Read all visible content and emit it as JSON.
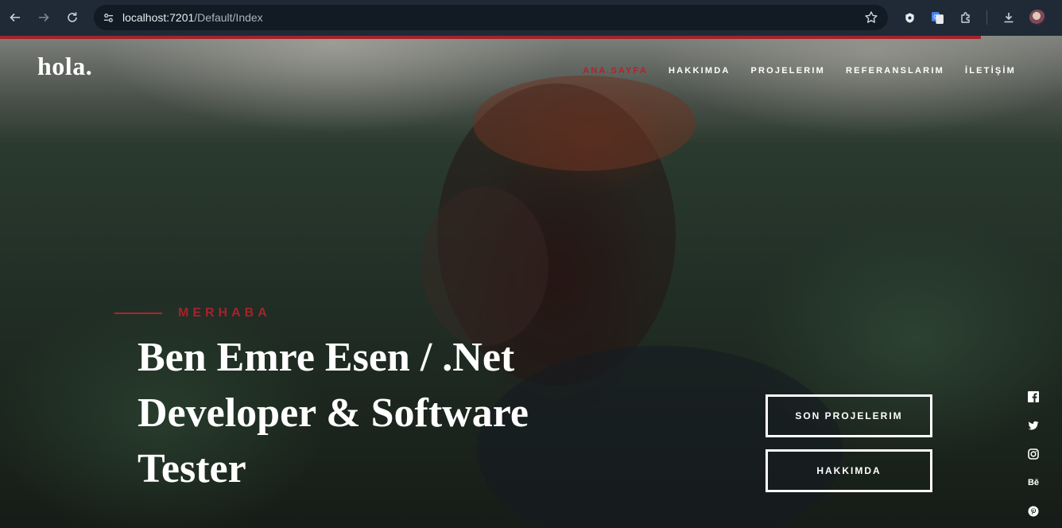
{
  "browser": {
    "url_host": "localhost:7201",
    "url_path": "/Default/Index"
  },
  "site": {
    "logo": "hola."
  },
  "nav": {
    "items": [
      {
        "label": "ANA SAYFA",
        "active": true
      },
      {
        "label": "HAKKIMDA",
        "active": false
      },
      {
        "label": "PROJELERIM",
        "active": false
      },
      {
        "label": "REFERANSLARIM",
        "active": false
      },
      {
        "label": "İLETİŞİM",
        "active": false
      }
    ]
  },
  "intro": {
    "pretitle": "MERHABA",
    "title": "Ben Emre Esen / .Net Developer & Software Tester"
  },
  "buttons": {
    "projects": "SON PROJELERIM",
    "about": "HAKKIMDA"
  },
  "social": {
    "behance_label": "Bē"
  },
  "colors": {
    "accent": "#b1242b",
    "chrome_bg": "#1f2a36",
    "omnibox_bg": "#121a23"
  },
  "icons": [
    "back-icon",
    "forward-icon",
    "reload-icon",
    "site-info-icon",
    "star-icon",
    "shield-extension-icon",
    "translate-extension-icon",
    "puzzle-icon",
    "download-icon",
    "facebook-icon",
    "twitter-icon",
    "instagram-icon",
    "behance-icon",
    "pinterest-icon"
  ]
}
